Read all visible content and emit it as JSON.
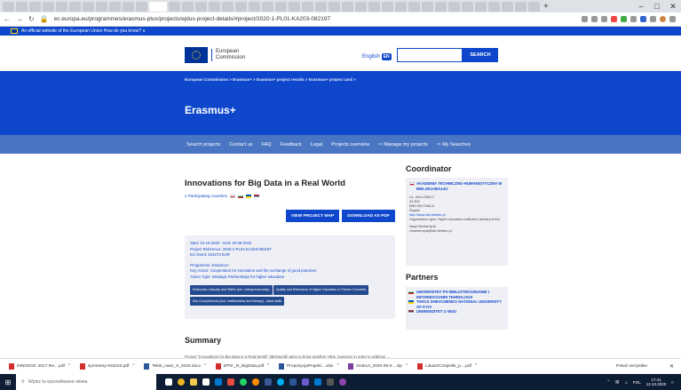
{
  "browser": {
    "url": "ec.europa.eu/programmes/erasmus-plus/projects/eplus-project-details/#project/2020-1-PL01-KA203-082197"
  },
  "eu_band": {
    "text": "An official website of the European Union   How do you know? ∨"
  },
  "header": {
    "logo_line1": "European",
    "logo_line2": "Commission",
    "language": "English",
    "lang_code": "EN",
    "search_button": "SEARCH"
  },
  "crumbs": "European Commission  >  Erasmus+  >  Erasmus+ project results  >  Erasmus+ project card  >",
  "site_title": "Erasmus+",
  "menu": [
    "Search projects",
    "Contact us",
    "FAQ",
    "Feedback",
    "Legal",
    "Projects overview",
    "⇨ Manage my projects",
    "⇨ My Searches"
  ],
  "project": {
    "title": "Innovations for Big Data in a Real World",
    "countries": "4 Participating countries",
    "btn_map": "VIEW PROJECT MAP",
    "btn_pdf": "DOWNLOAD AS PDF",
    "dates": "Start: 01-10-2020 - End: 30-09-2022",
    "reference": "Project Reference: 2020-1-PL01-KA203-082197",
    "grant": "EU Grant: 224273 EUR",
    "programme": "Programme: Erasmus+",
    "key_action": "Key Action: Cooperation for innovation and the exchange of good practices",
    "action_type": "Action Type: Strategic Partnerships for higher education",
    "chips": [
      "Enterprise, industry and SMEs (incl. entrepreneurship)",
      "Quality and Relevance of Higher Education in Partner Countries",
      "Key Competences (incl. mathematics and literacy) - basic skills"
    ]
  },
  "summary": {
    "heading": "Summary",
    "text": "Project \"Innovations for Big Data in a Real World\" (iBIGworld) aims to bring together HEIs, business in order to address ..."
  },
  "coordinator": {
    "heading": "Coordinator",
    "org": "AKADEMIA TECHNICZNO-HUMANISTYCZNA W BIELSKU-BIALEJ",
    "address": [
      "UL. WILLOWA 2",
      "43 309",
      "BIELSKO BIALA",
      "Śląskie"
    ],
    "website": "http://www.ath.bielsko.pl",
    "org_type": "Organisation type: Higher education institution (tertiary level)",
    "contact": [
      "Vasyl Martsenyuk",
      "vmartsenyuk@ath.bielsko.pl"
    ]
  },
  "partners": {
    "heading": "Partners",
    "items": [
      {
        "name": "UNIVERSITET PO BIBLIOTEKOZNANIE I INFORMACIONNI TEHNOLOGII",
        "flag": "bg"
      },
      {
        "name": "TARAS SHEVCHENKO NATIONAL UNIVERSITY OF KYIV",
        "flag": "ua"
      },
      {
        "name": "UNIWERZITET U NISU",
        "flag": "rs"
      }
    ]
  },
  "downloads": {
    "items": [
      {
        "name": "INNOSOC 2017 Re....pdf",
        "type": "pdf"
      },
      {
        "name": "symmetry-933323.pdf",
        "type": "pdf"
      },
      {
        "name": "Tekst_nasz_X_2020.docx",
        "type": "word"
      },
      {
        "name": "EPIC_R_BigData.pdf",
        "type": "pdf"
      },
      {
        "name": "PropozycjaProjekt....xlsx",
        "type": "word"
      },
      {
        "name": "Druk14_2020-06-0....zip",
        "type": "zip"
      },
      {
        "name": "LukaszCzepielik_p....pdf",
        "type": "pdf"
      }
    ],
    "show_all": "Pokaż wszystkie"
  },
  "taskbar": {
    "search_placeholder": "Wpisz tu wyszukiwane słowa",
    "lang": "POL",
    "time": "17:41",
    "date": "12.10.2020"
  }
}
